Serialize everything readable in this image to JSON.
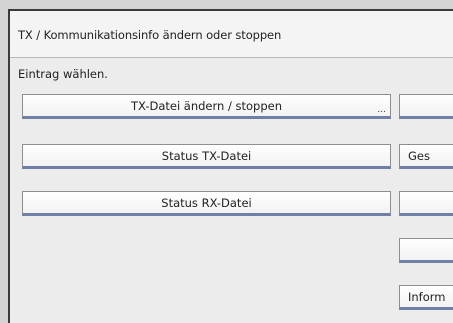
{
  "window": {
    "title": "TX / Kommunikationsinfo ändern oder stoppen"
  },
  "instruction": "Eintrag wählen.",
  "left_buttons": [
    {
      "label": "TX-Datei ändern / stoppen",
      "more": "..."
    },
    {
      "label": "Status TX-Datei"
    },
    {
      "label": "Status RX-Datei"
    }
  ],
  "right_buttons": [
    {
      "label": ""
    },
    {
      "label": "Ges"
    },
    {
      "label": ""
    },
    {
      "label": ""
    },
    {
      "label": "Inform"
    }
  ]
}
